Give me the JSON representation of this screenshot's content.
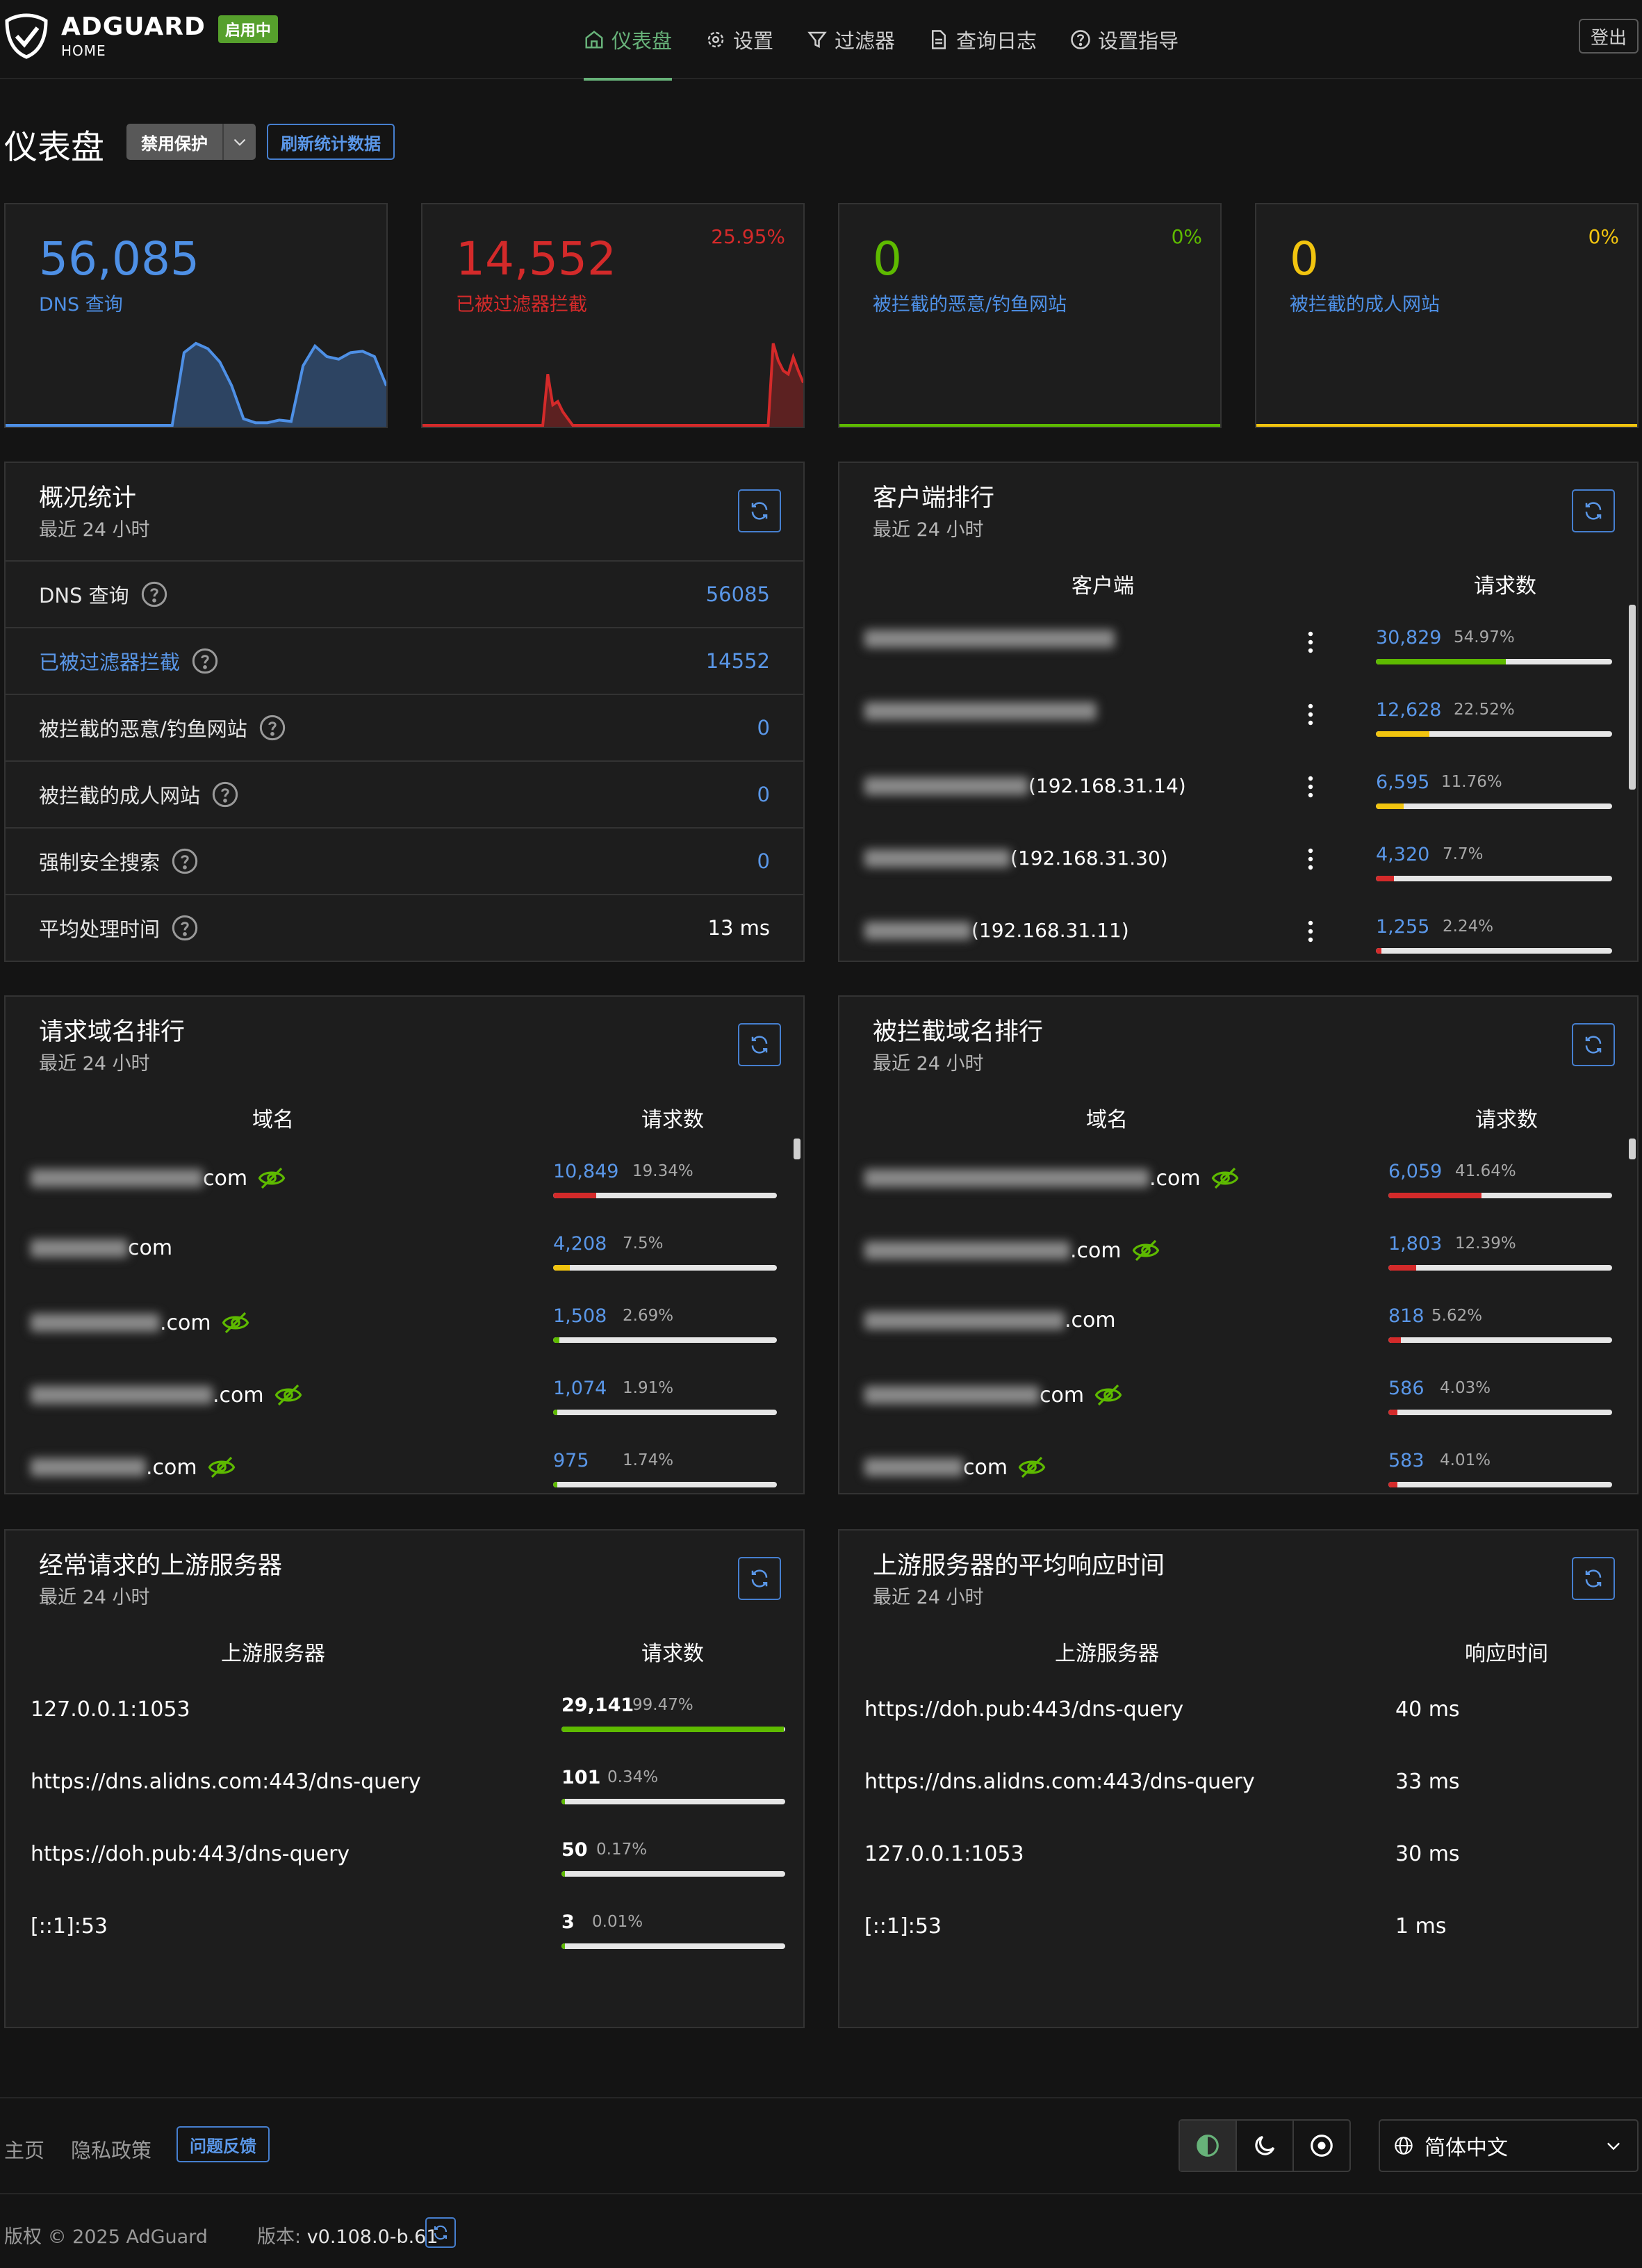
{
  "header": {
    "logo_title": "ADGUARD",
    "logo_sub": "HOME",
    "status_badge": "启用中",
    "nav": [
      "仪表盘",
      "设置",
      "过滤器",
      "查询日志",
      "设置指导"
    ],
    "logout": "登出"
  },
  "page": {
    "title": "仪表盘",
    "protect_button": "禁用保护",
    "refresh_stats": "刷新统计数据"
  },
  "stat_cards": [
    {
      "value": "56,085",
      "label": "DNS 查询",
      "percent": "",
      "color": "#4e90e6"
    },
    {
      "value": "14,552",
      "label": "已被过滤器拦截",
      "percent": "25.95%",
      "color": "#d42a2a"
    },
    {
      "value": "0",
      "label": "被拦截的恶意/钓鱼网站",
      "percent": "0%",
      "color": "#5eba00"
    },
    {
      "value": "0",
      "label": "被拦截的成人网站",
      "percent": "0%",
      "color": "#f1c40f"
    }
  ],
  "sparklines": {
    "dns": [
      0,
      0,
      0,
      0,
      0,
      0,
      0,
      0,
      0,
      0,
      0,
      0,
      0,
      0,
      0,
      55,
      62,
      58,
      48,
      30,
      5,
      2,
      2,
      4,
      3,
      45,
      60,
      52,
      50,
      55,
      56,
      52,
      30
    ],
    "blocked": [
      0,
      0,
      0,
      0,
      0,
      0,
      0,
      0,
      0,
      0,
      0,
      0,
      0,
      0,
      0,
      0,
      0,
      0,
      0,
      0,
      0,
      0,
      0,
      0,
      0,
      30,
      12,
      14,
      8,
      4,
      0,
      0,
      0,
      0,
      0,
      0,
      0,
      0,
      0,
      0,
      0,
      0,
      0,
      0,
      0,
      0,
      0,
      0,
      0,
      0,
      0,
      0,
      0,
      0,
      0,
      0,
      0,
      0,
      0,
      0,
      0,
      0,
      0,
      0,
      0,
      0,
      0,
      0,
      0,
      0,
      48,
      38,
      32,
      30,
      40,
      32,
      25
    ]
  },
  "general_stats": {
    "title": "概况统计",
    "subtitle": "最近 24 小时",
    "rows": [
      {
        "label": "DNS 查询",
        "value": "56085"
      },
      {
        "label": "已被过滤器拦截",
        "value": "14552"
      },
      {
        "label": "被拦截的恶意/钓鱼网站",
        "value": "0"
      },
      {
        "label": "被拦截的成人网站",
        "value": "0"
      },
      {
        "label": "强制安全搜索",
        "value": "0"
      },
      {
        "label": "平均处理时间",
        "value": "13 ms"
      }
    ]
  },
  "top_clients": {
    "title": "客户端排行",
    "subtitle": "最近 24 小时",
    "col_client": "客户端",
    "col_requests": "请求数",
    "rows": [
      {
        "ip": "",
        "count": "30,829",
        "pct": "54.97%",
        "fraction": 0.5497,
        "color": "#5eba00"
      },
      {
        "ip": "",
        "count": "12,628",
        "pct": "22.52%",
        "fraction": 0.2252,
        "color": "#f1c40f"
      },
      {
        "ip": "(192.168.31.14)",
        "count": "6,595",
        "pct": "11.76%",
        "fraction": 0.1176,
        "color": "#f1c40f"
      },
      {
        "ip": "(192.168.31.30)",
        "count": "4,320",
        "pct": "7.7%",
        "fraction": 0.077,
        "color": "#d42a2a"
      },
      {
        "ip": "(192.168.31.11)",
        "count": "1,255",
        "pct": "2.24%",
        "fraction": 0.0224,
        "color": "#d42a2a"
      }
    ]
  },
  "top_queried": {
    "title": "请求域名排行",
    "subtitle": "最近 24 小时",
    "col_domain": "域名",
    "col_requests": "请求数",
    "rows": [
      {
        "suffix": "com",
        "count": "10,849",
        "pct": "19.34%",
        "fraction": 0.1934,
        "color": "#d42a2a"
      },
      {
        "suffix": "com",
        "count": "4,208",
        "pct": "7.5%",
        "fraction": 0.075,
        "color": "#f1c40f"
      },
      {
        "suffix": ".com",
        "count": "1,508",
        "pct": "2.69%",
        "fraction": 0.0269,
        "color": "#5eba00"
      },
      {
        "suffix": ".com",
        "count": "1,074",
        "pct": "1.91%",
        "fraction": 0.0191,
        "color": "#5eba00"
      },
      {
        "suffix": ".com",
        "count": "975",
        "pct": "1.74%",
        "fraction": 0.0174,
        "color": "#5eba00"
      }
    ]
  },
  "top_blocked": {
    "title": "被拦截域名排行",
    "subtitle": "最近 24 小时",
    "col_domain": "域名",
    "col_requests": "请求数",
    "rows": [
      {
        "suffix": ".com",
        "count": "6,059",
        "pct": "41.64%",
        "fraction": 0.4164,
        "color": "#d42a2a"
      },
      {
        "suffix": ".com",
        "count": "1,803",
        "pct": "12.39%",
        "fraction": 0.1239,
        "color": "#d42a2a"
      },
      {
        "suffix": ".com",
        "count": "818",
        "pct": "5.62%",
        "fraction": 0.0562,
        "color": "#d42a2a"
      },
      {
        "suffix": "com",
        "count": "586",
        "pct": "4.03%",
        "fraction": 0.0403,
        "color": "#d42a2a"
      },
      {
        "suffix": "com",
        "count": "583",
        "pct": "4.01%",
        "fraction": 0.0401,
        "color": "#d42a2a"
      }
    ]
  },
  "top_upstreams": {
    "title": "经常请求的上游服务器",
    "subtitle": "最近 24 小时",
    "col_server": "上游服务器",
    "col_requests": "请求数",
    "rows": [
      {
        "server": "127.0.0.1:1053",
        "count": "29,141",
        "pct": "99.47%",
        "fraction": 0.9947,
        "color": "#5eba00"
      },
      {
        "server": "https://dns.alidns.com:443/dns-query",
        "count": "101",
        "pct": "0.34%",
        "fraction": 0.0034,
        "color": "#5eba00"
      },
      {
        "server": "https://doh.pub:443/dns-query",
        "count": "50",
        "pct": "0.17%",
        "fraction": 0.0017,
        "color": "#5eba00"
      },
      {
        "server": "[::1]:53",
        "count": "3",
        "pct": "0.01%",
        "fraction": 0.0001,
        "color": "#5eba00"
      }
    ]
  },
  "upstream_avg_time": {
    "title": "上游服务器的平均响应时间",
    "subtitle": "最近 24 小时",
    "col_server": "上游服务器",
    "col_time": "响应时间",
    "rows": [
      {
        "server": "https://doh.pub:443/dns-query",
        "time": "40 ms"
      },
      {
        "server": "https://dns.alidns.com:443/dns-query",
        "time": "33 ms"
      },
      {
        "server": "127.0.0.1:1053",
        "time": "30 ms"
      },
      {
        "server": "[::1]:53",
        "time": "1 ms"
      }
    ]
  },
  "footer": {
    "home": "主页",
    "privacy": "隐私政策",
    "feedback": "问题反馈",
    "language": "简体中文",
    "copyright": "版权 © 2025 AdGuard",
    "version_label": "版本: ",
    "version": "v0.108.0-b.61"
  }
}
